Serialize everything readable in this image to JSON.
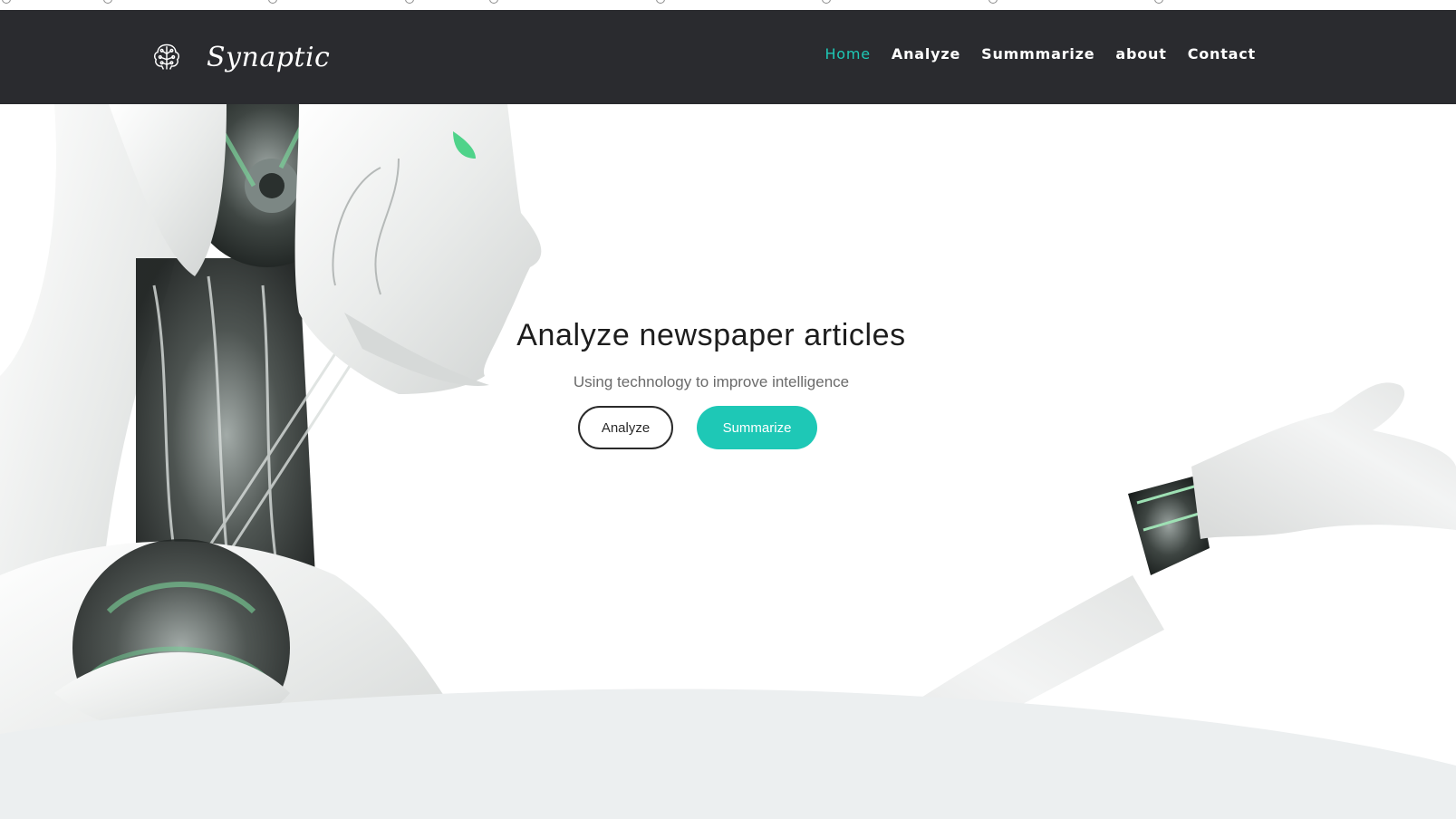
{
  "brand": {
    "name": "Synaptic",
    "icon": "brain-circuit-icon"
  },
  "nav": {
    "items": [
      {
        "label": "Home",
        "active": true
      },
      {
        "label": "Analyze",
        "active": false
      },
      {
        "label": "Summmarize",
        "active": false
      },
      {
        "label": "about",
        "active": false
      },
      {
        "label": "Contact",
        "active": false
      }
    ]
  },
  "hero": {
    "title": "Analyze newspaper articles",
    "subtitle": "Using technology to improve intelligence",
    "primary_button": "Analyze",
    "secondary_button": "Summarize",
    "background_image": "white-humanoid-robot"
  },
  "colors": {
    "navbar": "#2a2b2f",
    "accent": "#1ec8b6",
    "wave": "#eceff0"
  }
}
